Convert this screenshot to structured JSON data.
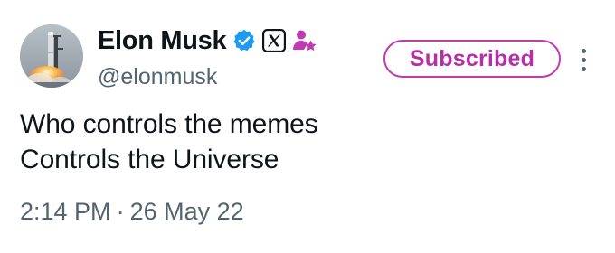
{
  "author": {
    "display_name": "Elon Musk",
    "handle": "@elonmusk",
    "avatar": "rocket-launch-photo",
    "badges": [
      {
        "icon": "verified-badge-icon",
        "color": "#1d9bf0"
      },
      {
        "icon": "x-affiliate-badge-icon",
        "color": "#0f1419"
      },
      {
        "icon": "subscriber-badge-icon",
        "color": "#c13ab4"
      }
    ]
  },
  "actions": {
    "subscribe_label": "Subscribed",
    "subscribe_color": "#c13ab4",
    "more_icon": "more-vertical-icon"
  },
  "tweet": {
    "lines": [
      "Who controls the memes",
      "Controls the Universe"
    ],
    "time": "2:14 PM",
    "separator": "·",
    "date": "26 May 22"
  }
}
